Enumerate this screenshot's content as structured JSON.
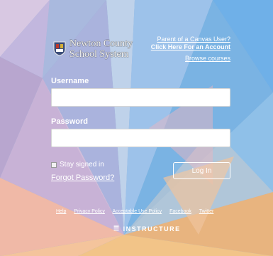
{
  "logo": {
    "line1": "Newton County",
    "line2": "School System"
  },
  "top_links": {
    "parent_line1": "Parent of a Canvas User?",
    "parent_line2": "Click Here For an Account",
    "browse": "Browse courses"
  },
  "form": {
    "username_label": "Username",
    "username_value": "",
    "password_label": "Password",
    "password_value": "",
    "stay_signed_in": "Stay signed in",
    "forgot": "Forgot Password?",
    "login_button": "Log In"
  },
  "footer": {
    "links": [
      "Help",
      "Privacy Policy",
      "Acceptable Use Policy",
      "Facebook",
      "Twitter"
    ],
    "brand": "INSTRUCTURE"
  }
}
